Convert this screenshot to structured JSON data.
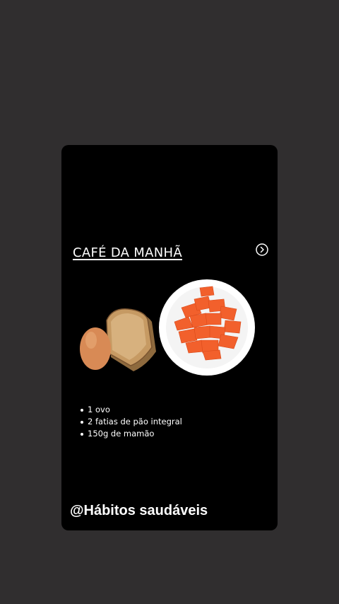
{
  "story": {
    "title": "CAFÉ DA MANHÃ",
    "next_icon": "chevron-right-circle-icon",
    "items": [
      "1 ovo",
      "2 fatias de pão integral",
      "150g de mamão"
    ],
    "handle": "@Hábitos saudáveis"
  },
  "colors": {
    "background": "#302e2f",
    "card": "#000000",
    "text": "#ffffff",
    "papaya": "#f2602c",
    "egg": "#d68a55",
    "bread": "#b48a55",
    "plate": "#ffffff"
  }
}
